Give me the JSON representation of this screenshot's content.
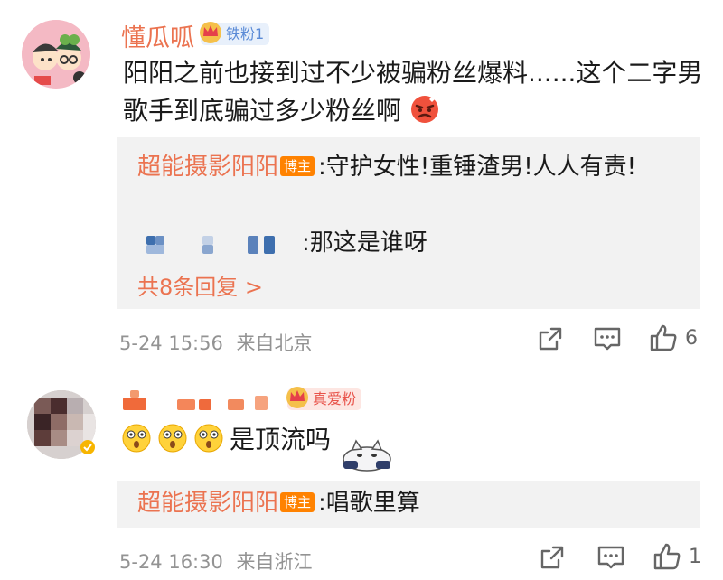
{
  "comments": [
    {
      "username": "懂瓜呱",
      "badge": "铁粉1",
      "text": "阳阳之前也接到过不少被骗粉丝爆料......这个二字男歌手到底骗过多少粉丝啊",
      "replies": [
        {
          "user": "超能摄影阳阳",
          "role": "博主",
          "text": ":守护女性!重锤渣男!人人有责!"
        },
        {
          "user": "",
          "role": "",
          "text": ":那这是谁呀"
        }
      ],
      "more_replies": "共8条回复 >",
      "time": "5-24 15:56",
      "location": "来自北京",
      "like_count": "6"
    },
    {
      "username": "",
      "badge": "真爱粉",
      "text": "是顶流吗",
      "replies": [
        {
          "user": "超能摄影阳阳",
          "role": "博主",
          "text": ":唱歌里算"
        }
      ],
      "time": "5-24 16:30",
      "location": "来自浙江",
      "like_count": "1"
    }
  ],
  "colors": {
    "username": "#eb7350",
    "reply_bg": "#f2f2f2",
    "meta": "#939393",
    "host_badge": "#ff8200"
  },
  "icons": [
    "share-icon",
    "comment-icon",
    "like-icon",
    "crown-icon",
    "surprised-emoji",
    "angry-emoji",
    "cat-sticker"
  ]
}
